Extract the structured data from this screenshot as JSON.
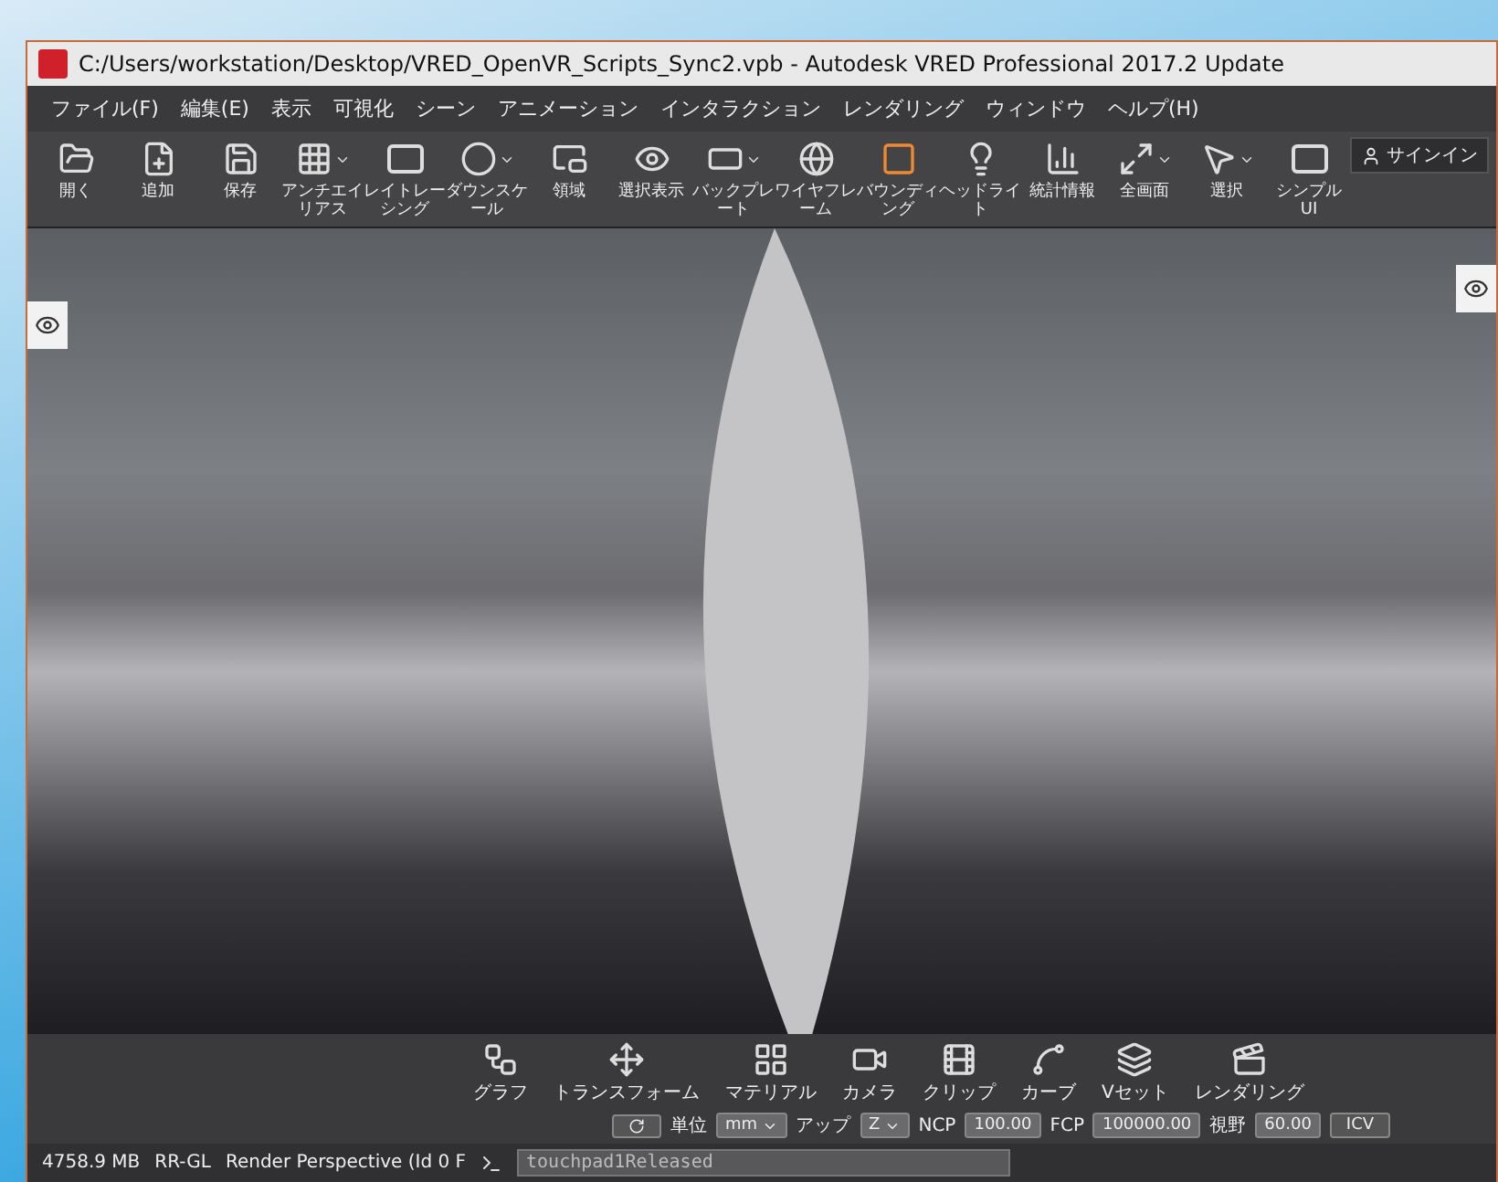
{
  "window": {
    "title": "C:/Users/workstation/Desktop/VRED_OpenVR_Scripts_Sync2.vpb - Autodesk VRED Professional 2017.2 Update"
  },
  "menu": [
    "ファイル(F)",
    "編集(E)",
    "表示",
    "可視化",
    "シーン",
    "アニメーション",
    "インタラクション",
    "レンダリング",
    "ウィンドウ",
    "ヘルプ(H)"
  ],
  "toolbar": [
    {
      "label": "開く",
      "has_menu": false,
      "active": false
    },
    {
      "label": "追加",
      "has_menu": false,
      "active": false
    },
    {
      "label": "保存",
      "has_menu": false,
      "active": false
    },
    {
      "label": "アンチエイリアス",
      "has_menu": true,
      "active": false
    },
    {
      "label": "レイトレーシング",
      "has_menu": false,
      "active": false
    },
    {
      "label": "ダウンスケール",
      "has_menu": true,
      "active": false
    },
    {
      "label": "領域",
      "has_menu": false,
      "active": false
    },
    {
      "label": "選択表示",
      "has_menu": false,
      "active": false
    },
    {
      "label": "バックプレート",
      "has_menu": true,
      "active": false
    },
    {
      "label": "ワイヤフレーム",
      "has_menu": false,
      "active": false
    },
    {
      "label": "バウンディング",
      "has_menu": false,
      "active": true
    },
    {
      "label": "ヘッドライト",
      "has_menu": false,
      "active": false
    },
    {
      "label": "統計情報",
      "has_menu": false,
      "active": false
    },
    {
      "label": "全画面",
      "has_menu": true,
      "active": false
    },
    {
      "label": "選択",
      "has_menu": true,
      "active": false
    },
    {
      "label": "シンプル UI",
      "has_menu": false,
      "active": false
    }
  ],
  "sign_in": "サインイン",
  "bottom_tools": [
    "グラフ",
    "トランスフォーム",
    "マテリアル",
    "カメラ",
    "クリップ",
    "カーブ",
    "Vセット",
    "レンダリング"
  ],
  "camera_controls": {
    "unit_label": "単位",
    "unit": "mm",
    "up_label": "アップ",
    "up": "Z",
    "ncp_label": "NCP",
    "ncp": "100.00",
    "fcp_label": "FCP",
    "fcp": "100000.00",
    "fov_label": "視野",
    "fov": "60.00",
    "icv": "ICV"
  },
  "status_bar": {
    "memory": "4758.9 MB",
    "renderer": "RR-GL",
    "view": "Render Perspective (Id 0 F",
    "command": "touchpad1Released"
  }
}
